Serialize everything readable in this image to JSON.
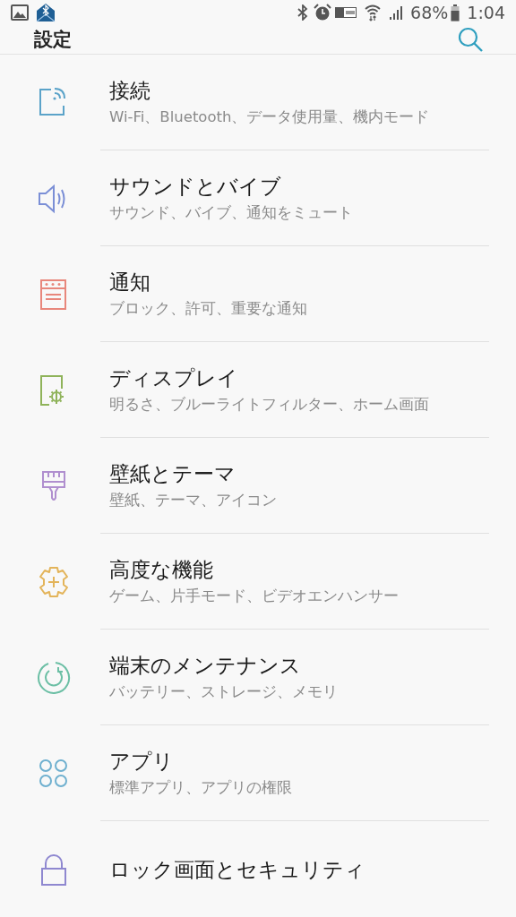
{
  "status_bar": {
    "battery": "68%",
    "time": "1:04"
  },
  "header": {
    "title": "設定"
  },
  "items": [
    {
      "kind": "connections",
      "color": "#5ba3c9",
      "title": "接続",
      "subtitle": "Wi-Fi、Bluetooth、データ使用量、機内モード"
    },
    {
      "kind": "sound",
      "color": "#7b8fd6",
      "title": "サウンドとバイブ",
      "subtitle": "サウンド、バイブ、通知をミュート"
    },
    {
      "kind": "notifications",
      "color": "#e8877c",
      "title": "通知",
      "subtitle": "ブロック、許可、重要な通知"
    },
    {
      "kind": "display",
      "color": "#8fb35a",
      "title": "ディスプレイ",
      "subtitle": "明るさ、ブルーライトフィルター、ホーム画面"
    },
    {
      "kind": "wallpaper",
      "color": "#b08fcf",
      "title": "壁紙とテーマ",
      "subtitle": "壁紙、テーマ、アイコン"
    },
    {
      "kind": "advanced",
      "color": "#e3b45a",
      "title": "高度な機能",
      "subtitle": "ゲーム、片手モード、ビデオエンハンサー"
    },
    {
      "kind": "maintenance",
      "color": "#6cbfa5",
      "title": "端末のメンテナンス",
      "subtitle": "バッテリー、ストレージ、メモリ"
    },
    {
      "kind": "apps",
      "color": "#6fb0cf",
      "title": "アプリ",
      "subtitle": "標準アプリ、アプリの権限"
    },
    {
      "kind": "lock",
      "color": "#8f88d0",
      "title": "ロック画面とセキュリティ"
    }
  ]
}
